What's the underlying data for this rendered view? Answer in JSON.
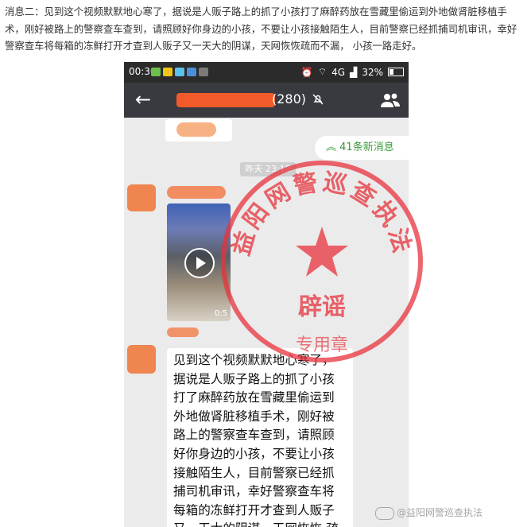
{
  "caption": "消息二：见到这个视频默默地心寒了，据说是人贩子路上的抓了小孩打了麻醉药放在雪藏里偷运到外地做肾脏移植手术，刚好被路上的警察查车查到，请照顾好你身边的小孩，不要让小孩接触陌生人，目前警察已经抓捕司机审讯，幸好警察查车将每箱的冻鲜打开才查到人贩子又一天大的阴谋，天网恢恢疏而不漏， 小孩一路走好。",
  "statusbar": {
    "time": "00:30",
    "network": "4G",
    "battery": "32%"
  },
  "chat": {
    "member_count": "(280)",
    "new_messages": "41条新消息",
    "timestamp": "昨天 23:18",
    "video_duration": "0:5",
    "message": "见到这个视频默默地心寒了，据说是人贩子路上的抓了小孩打了麻醉药放在雪藏里偷运到外地做肾脏移植手术，刚好被路上的警察查车查到，请照顾好你身边的小孩，不要让小孩接触陌生人，目前警察已经抓捕司机审讯，幸好警察查车将每箱的冻鲜打开才查到人贩子又一天大的阴谋，天网恢恢 疏而不漏，小孩一路走好🙏🙏🙏"
  },
  "stamp": {
    "top_text": "益阳网警巡查执法",
    "main_text": "辟谣",
    "sub_text": "专用章",
    "color": "#e8323c"
  },
  "watermark": "@益阳网警巡查执法",
  "colors": {
    "navbar": "#393a3f",
    "new_msg_green": "#3a9a3a",
    "redaction": "#f25a2a"
  }
}
